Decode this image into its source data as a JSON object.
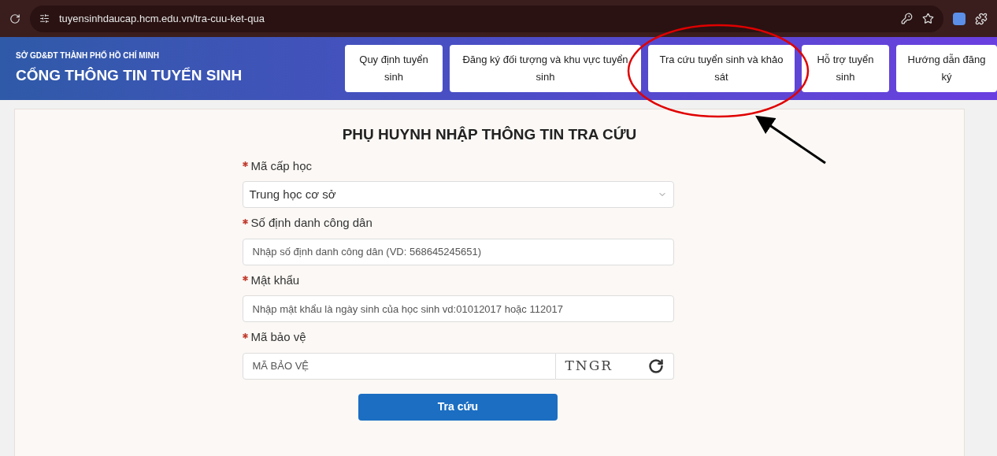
{
  "browser": {
    "url": "tuyensinhdaucap.hcm.edu.vn/tra-cuu-ket-qua"
  },
  "header": {
    "subtitle": "SỞ GD&ĐT THÀNH PHỐ HỒ CHÍ MINH",
    "title": "CỔNG THÔNG TIN TUYỂN SINH"
  },
  "nav": [
    {
      "label": "Quy định tuyển sinh"
    },
    {
      "label": "Đăng ký đối tượng và khu vực tuyển sinh"
    },
    {
      "label": "Tra cứu tuyển sinh và khảo sát"
    },
    {
      "label": "Hỗ trợ tuyển sinh"
    },
    {
      "label": "Hướng dẫn đăng ký"
    }
  ],
  "form": {
    "title": "PHỤ HUYNH NHẬP THÔNG TIN TRA CỨU",
    "fields": [
      {
        "kind": "select",
        "label": "Mã cấp học",
        "required": true,
        "value": "Trung học cơ sở"
      },
      {
        "kind": "text",
        "label": "Số định danh công dân",
        "required": true,
        "placeholder": "Nhập số định danh công dân (VD: 568645245651)"
      },
      {
        "kind": "text",
        "label": "Mật khẩu",
        "required": true,
        "placeholder": "Nhập mật khẩu là ngày sinh của học sinh vd:01012017 hoặc 112017"
      },
      {
        "kind": "captcha",
        "label": "Mã bảo vệ",
        "required": true,
        "placeholder": "MÃ BẢO VỆ",
        "captcha": "TNGR"
      }
    ],
    "submit": "Tra cứu"
  }
}
